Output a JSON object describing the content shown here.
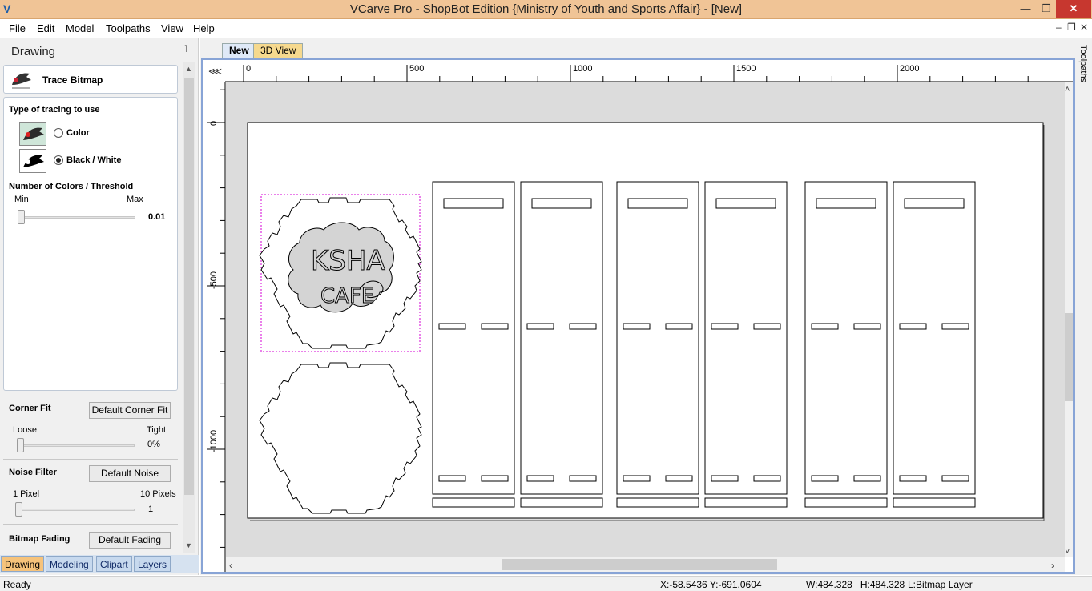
{
  "window": {
    "title": "VCarve Pro - ShopBot Edition {Ministry of Youth and Sports Affair} - [New]",
    "min": "—",
    "restore": "❐",
    "close": "✕"
  },
  "menu": {
    "items": [
      "File",
      "Edit",
      "Model",
      "Toolpaths",
      "View",
      "Help"
    ],
    "mdi_min": "–",
    "mdi_restore": "❐",
    "mdi_close": "✕"
  },
  "panel": {
    "title": "Drawing",
    "pin": "⍑",
    "tool_title": "Trace Bitmap",
    "tracing_heading": "Type of tracing to use",
    "option_color": "Color",
    "option_bw": "Black / White",
    "selected_option": "Black / White",
    "threshold_heading": "Number of Colors / Threshold",
    "min_label": "Min",
    "max_label": "Max",
    "threshold_value": "0.01",
    "threshold_fraction": 0.02,
    "corner_fit_heading": "Corner Fit",
    "corner_fit_button": "Default Corner Fit",
    "loose_label": "Loose",
    "tight_label": "Tight",
    "corner_fit_value": "0%",
    "corner_fit_fraction": 0.0,
    "noise_heading": "Noise Filter",
    "noise_button": "Default Noise",
    "noise_min_label": "1 Pixel",
    "noise_max_label": "10 Pixels",
    "noise_value": "1",
    "noise_fraction": 0.0,
    "fading_heading": "Bitmap Fading",
    "fading_button": "Default Fading"
  },
  "bottom_tabs": [
    "Drawing",
    "Modeling",
    "Clipart",
    "Layers"
  ],
  "doc_tabs": [
    "New",
    "3D View"
  ],
  "ruler": {
    "h_ticks": [
      "0",
      "500",
      "1000",
      "1500",
      "2000"
    ],
    "v_ticks": [
      "0",
      "-500",
      "-1000"
    ]
  },
  "artwork": {
    "logo_line1": "KSHA",
    "logo_line2": "CAFE"
  },
  "right_panel_label": "Toolpaths",
  "status": {
    "ready": "Ready",
    "coords": "X:-58.5436 Y:-691.0604",
    "size": "W:484.328   H:484.328",
    "layer": "L:Bitmap Layer"
  },
  "colors": {
    "accent_tab": "#f6c37b",
    "view_frame": "#88a4d6",
    "titlebar": "#f0c496",
    "selection": "#d400d4"
  }
}
